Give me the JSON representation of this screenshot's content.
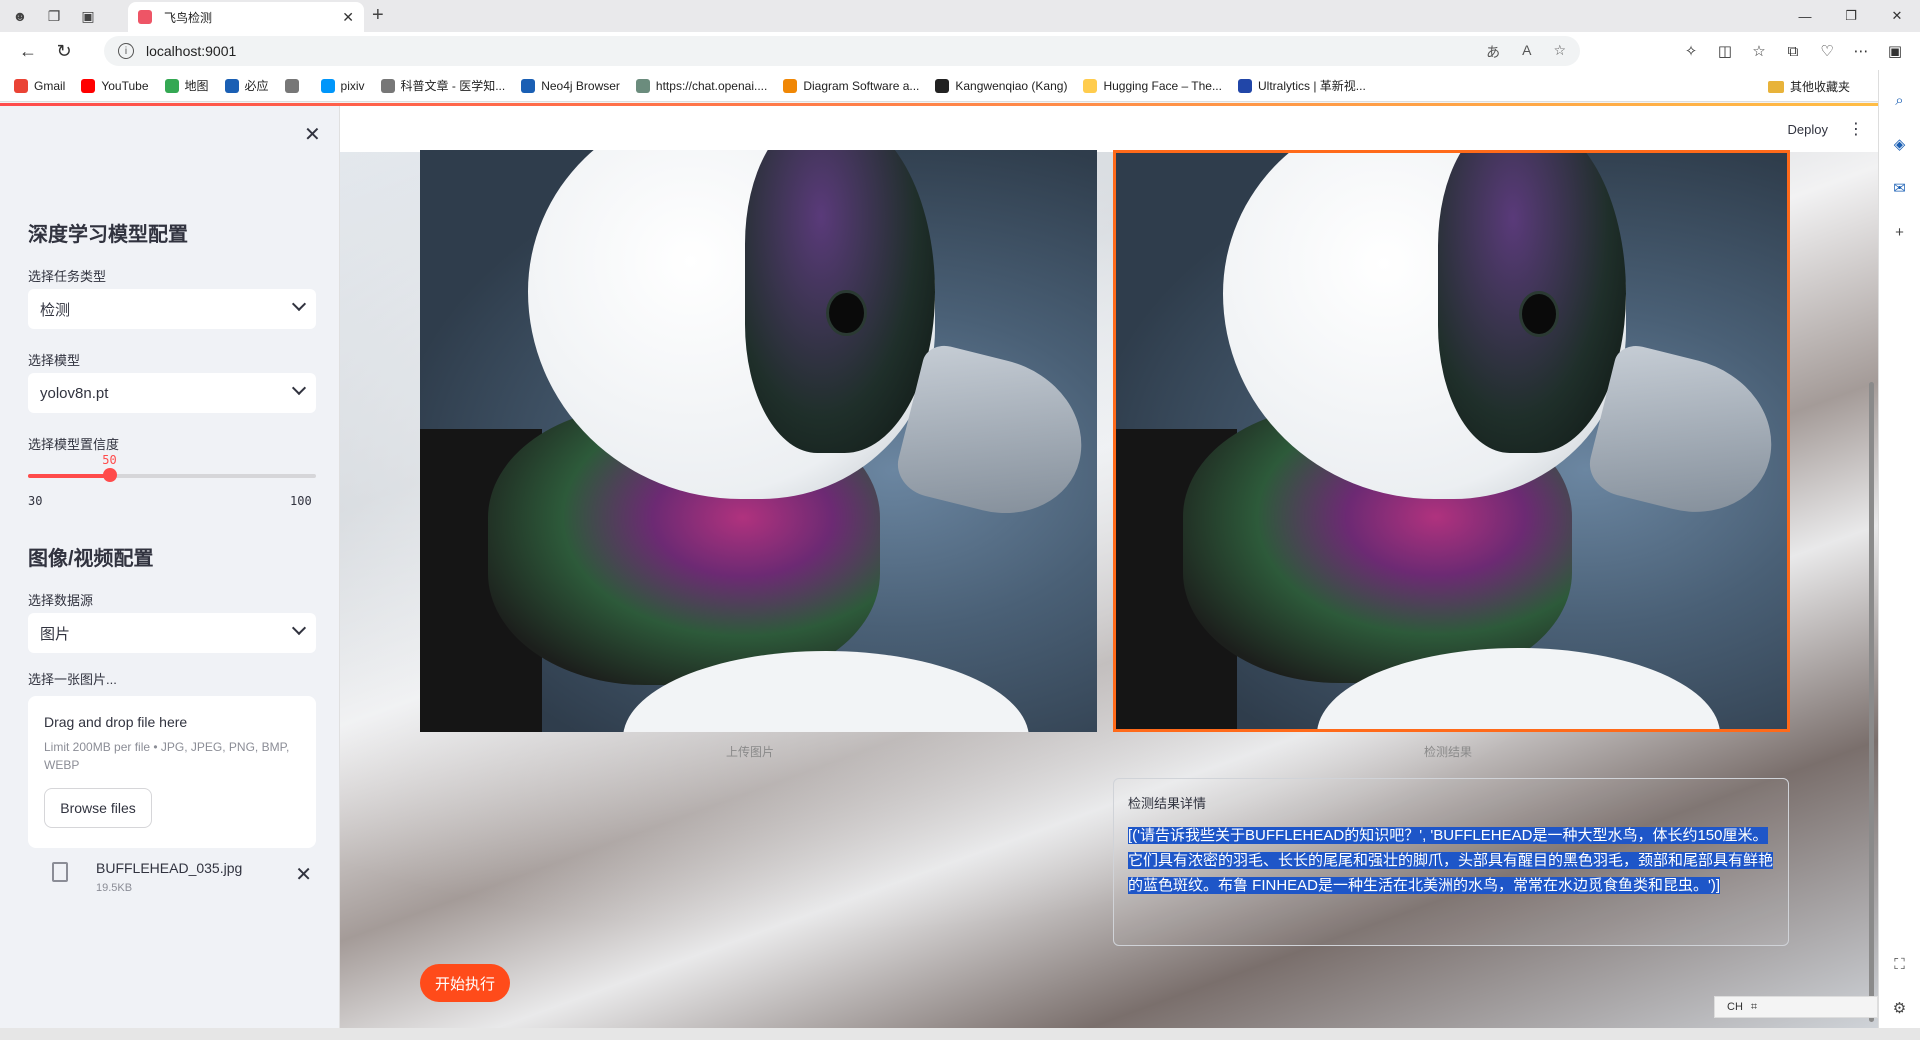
{
  "browser": {
    "tab_title": "飞鸟检测",
    "url": "localhost:9001",
    "bookmarks": [
      {
        "label": "Gmail",
        "color": "#ea4335"
      },
      {
        "label": "YouTube",
        "color": "#ff0000"
      },
      {
        "label": "地图",
        "color": "#34a853"
      },
      {
        "label": "必应",
        "color": "#1a5fb4"
      },
      {
        "label": "",
        "color": "#777777"
      },
      {
        "label": "pixiv",
        "color": "#0096fa"
      },
      {
        "label": "科普文章 - 医学知...",
        "color": "#777777"
      },
      {
        "label": "Neo4j Browser",
        "color": "#1a5fb4"
      },
      {
        "label": "https://chat.openai....",
        "color": "#6b8c7d"
      },
      {
        "label": "Diagram Software a...",
        "color": "#f08705"
      },
      {
        "label": "Kangwenqiao (Kang)",
        "color": "#222222"
      },
      {
        "label": "Hugging Face – The...",
        "color": "#ffcc4d"
      },
      {
        "label": "Ultralytics | 革新视...",
        "color": "#2146a8"
      }
    ],
    "other_bookmarks": "其他收藏夹"
  },
  "header": {
    "deploy_label": "Deploy"
  },
  "sidebar": {
    "model_section_title": "深度学习模型配置",
    "task_label": "选择任务类型",
    "task_value": "检测",
    "model_label": "选择模型",
    "model_value": "yolov8n.pt",
    "confidence_label": "选择模型置信度",
    "confidence": {
      "value": 50,
      "min": 30,
      "max": 100
    },
    "source_section_title": "图像/视频配置",
    "source_label": "选择数据源",
    "source_value": "图片",
    "upload_label": "选择一张图片...",
    "uploader": {
      "title": "Drag and drop file here",
      "limit": "Limit 200MB per file • JPG, JPEG, PNG, BMP, WEBP",
      "browse_label": "Browse files"
    },
    "file": {
      "name": "BUFFLEHEAD_035.jpg",
      "size": "19.5KB"
    }
  },
  "main": {
    "original_caption": "上传图片",
    "result_caption": "检测结果",
    "detail_label": "检测结果详情",
    "detail_text": "[('请告诉我些关于BUFFLEHEAD的知识吧？', 'BUFFLEHEAD是一种大型水鸟，体长约150厘米。它们具有浓密的羽毛、长长的尾尾和强壮的脚爪，头部具有醒目的黑色羽毛，颈部和尾部具有鲜艳的蓝色斑纹。布鲁 FINHEAD是一种生活在北美洲的水鸟，常常在水边觅食鱼类和昆虫。')]",
    "run_button": "开始执行"
  },
  "ime": {
    "label": "CH"
  },
  "colors": {
    "primary": "#ff4b4b",
    "run_button": "#ff4b1a",
    "result_border": "#ff6a1a",
    "selection": "#1e56c8"
  }
}
